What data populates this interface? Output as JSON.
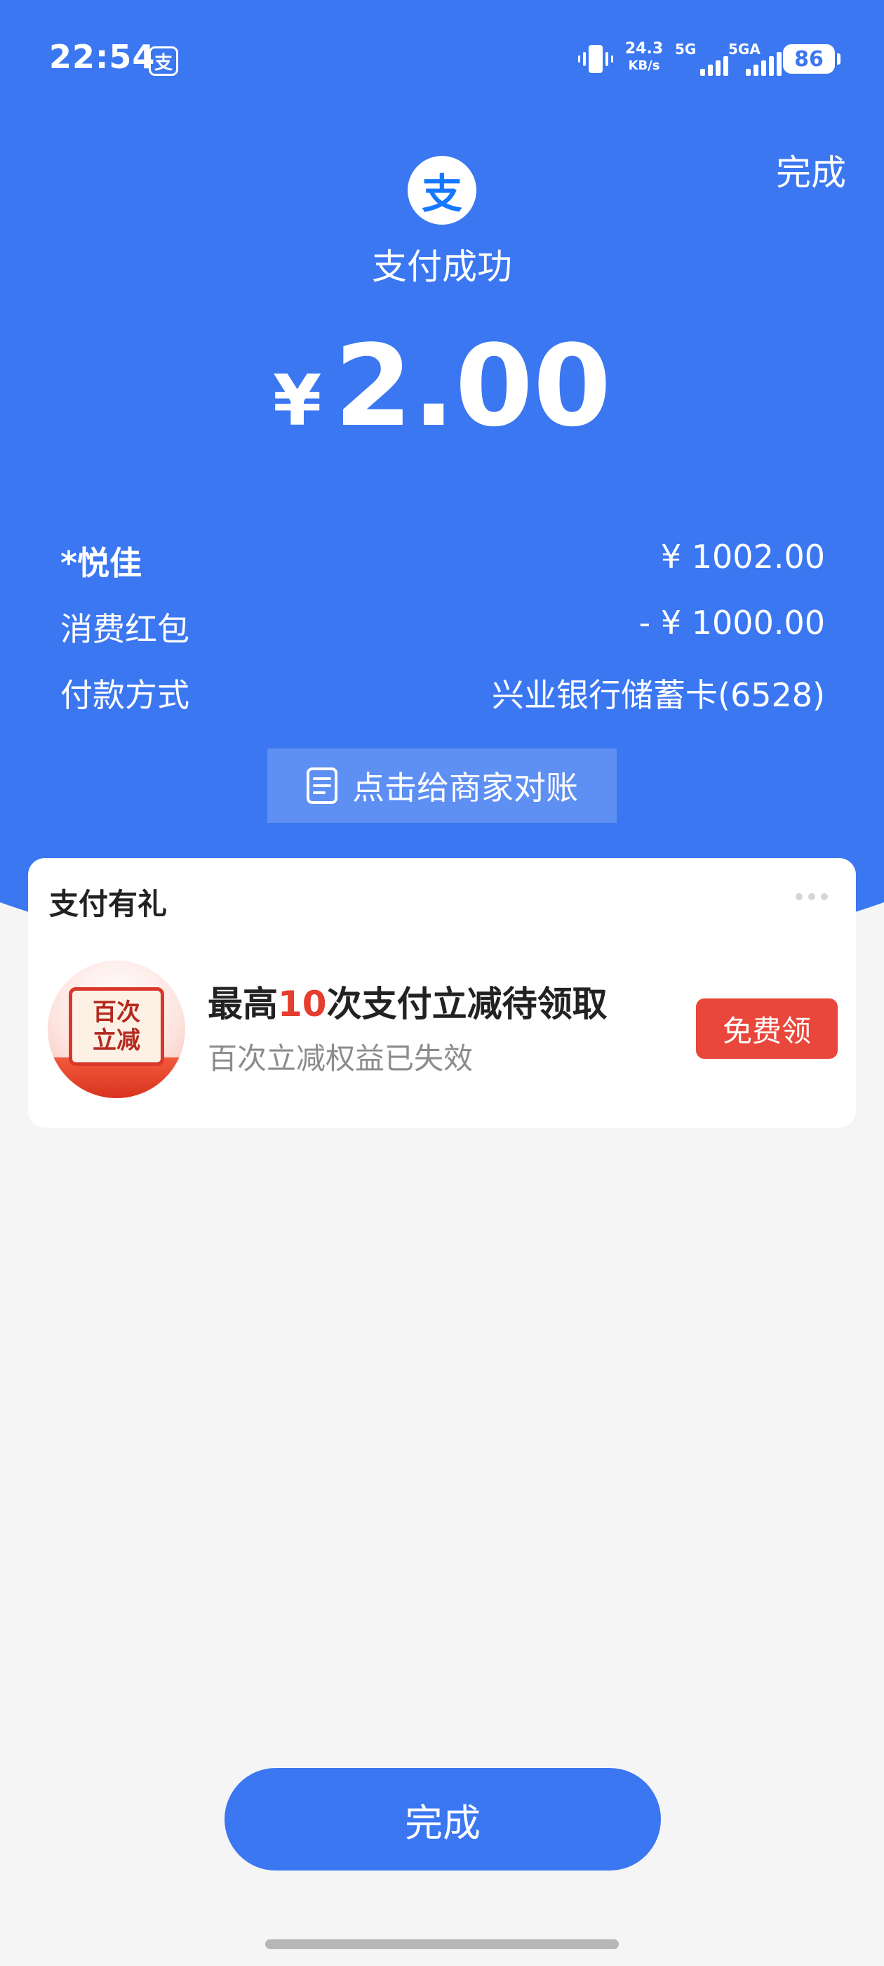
{
  "status_bar": {
    "time": "22:54",
    "app_icon": "支",
    "net_speed_value": "24.3",
    "net_speed_unit": "KB/s",
    "signal_1_label": "5G",
    "signal_2_label": "5GA",
    "battery": "86"
  },
  "header": {
    "done_label": "完成",
    "logo_glyph": "支",
    "title": "支付成功"
  },
  "amount": {
    "currency": "¥",
    "value": "2.00"
  },
  "details": [
    {
      "label": "*悦佳",
      "value": "¥ 1002.00"
    },
    {
      "label": "消费红包",
      "value": "- ¥ 1000.00"
    },
    {
      "label": "付款方式",
      "value": "兴业银行储蓄卡(6528)"
    }
  ],
  "reconcile_button": {
    "label": "点击给商家对账"
  },
  "gift_card": {
    "title": "支付有礼",
    "promo_icon_line1": "百次",
    "promo_icon_line2": "立减",
    "headline_prefix": "最高",
    "headline_highlight": "10",
    "headline_suffix": "次支付立减待领取",
    "subtitle": "百次立减权益已失效",
    "button_label": "免费领"
  },
  "footer": {
    "done_label": "完成"
  },
  "colors": {
    "primary_blue": "#3b77f1",
    "accent_red": "#e9473b",
    "background": "#f5f5f5"
  }
}
